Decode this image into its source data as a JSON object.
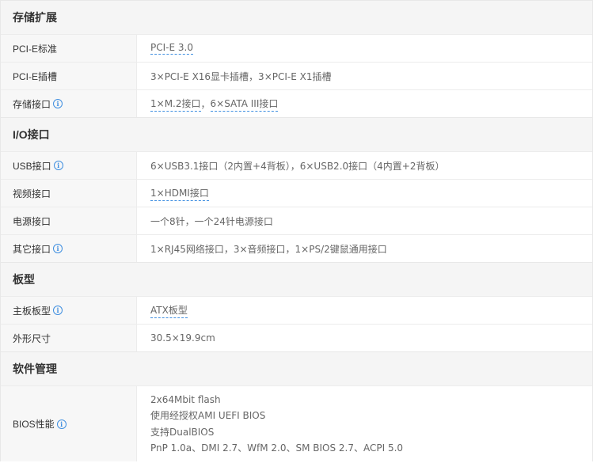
{
  "sections": {
    "storage": {
      "title": "存储扩展",
      "pcie_standard": {
        "label": "PCI-E标准",
        "value": "PCI-E 3.0"
      },
      "pcie_slots": {
        "label": "PCI-E插槽",
        "value": "3×PCI-E X16显卡插槽，3×PCI-E X1插槽"
      },
      "storage_ports": {
        "label": "存储接口",
        "value_part1": "1×M.2接口",
        "separator": "，",
        "value_part2": "6×SATA III接口"
      }
    },
    "io": {
      "title": "I/O接口",
      "usb": {
        "label": "USB接口",
        "value": "6×USB3.1接口（2内置+4背板），6×USB2.0接口（4内置+2背板）"
      },
      "video": {
        "label": "视频接口",
        "value": "1×HDMI接口"
      },
      "power": {
        "label": "电源接口",
        "value": "一个8针，一个24针电源接口"
      },
      "other": {
        "label": "其它接口",
        "value": "1×RJ45网络接口，3×音频接口，1×PS/2键鼠通用接口"
      }
    },
    "board": {
      "title": "板型",
      "form_factor": {
        "label": "主板板型",
        "value": "ATX板型"
      },
      "dimensions": {
        "label": "外形尺寸",
        "value": "30.5×19.9cm"
      }
    },
    "software": {
      "title": "软件管理",
      "bios": {
        "label": "BIOS性能",
        "lines": [
          "2x64Mbit flash",
          "使用经授权AMI UEFI BIOS",
          "支持DualBIOS",
          "PnP 1.0a、DMI 2.7、WfM 2.0、SM BIOS 2.7、ACPI 5.0"
        ]
      }
    }
  },
  "icons": {
    "info": "info-circle-icon",
    "info_glyph": "i"
  },
  "colors": {
    "section_bg": "#f5f5f5",
    "label_bg": "#f7f7f7",
    "link_accent": "#3e8ee0",
    "value_text": "#666666"
  }
}
